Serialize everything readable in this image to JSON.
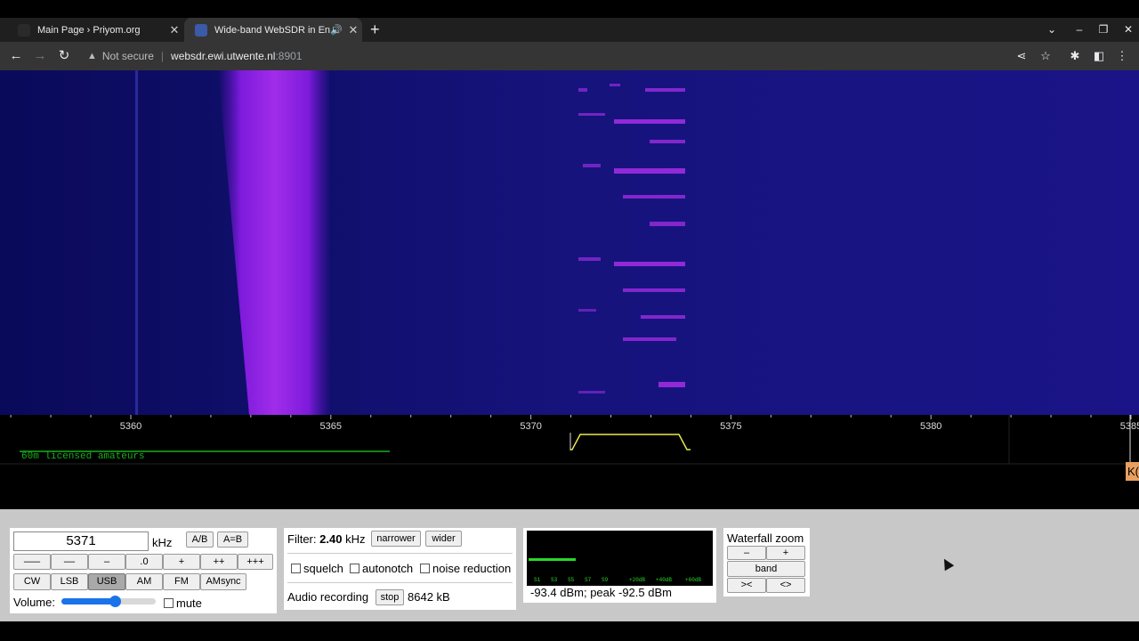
{
  "browser": {
    "tabs": [
      {
        "title": "Main Page › Priyom.org",
        "active": false
      },
      {
        "title": "Wide-band WebSDR in Ensch",
        "active": true
      }
    ],
    "url_warning": "Not secure",
    "url_host": "websdr.ewi.utwente.nl",
    "url_port": ":8901"
  },
  "scale": {
    "unit_labels": [
      "5360",
      "5365",
      "5370",
      "5375",
      "5380",
      "5385"
    ],
    "band_label": "60m licensed amateurs",
    "marker_label": "K("
  },
  "tuning": {
    "frequency": "5371",
    "unit": "kHz",
    "ab_label": "A/B",
    "aeqb_label": "A=B",
    "step_buttons": [
      "–––",
      "––",
      "–",
      ".0",
      "+",
      "++",
      "+++"
    ],
    "modes": [
      "CW",
      "LSB",
      "USB",
      "AM",
      "FM",
      "AMsync"
    ],
    "selected_mode": "USB",
    "volume_label": "Volume:",
    "volume_level": 0.57,
    "mute_label": "mute"
  },
  "filter": {
    "label": "Filter:",
    "width": "2.40",
    "unit": "kHz",
    "narrower": "narrower",
    "wider": "wider",
    "squelch": "squelch",
    "autonotch": "autonotch",
    "noise_reduction": "noise reduction",
    "recording_label": "Audio recording",
    "stop": "stop",
    "recorded_size": "8642 kB"
  },
  "smeter": {
    "labels": [
      "S1",
      "S3",
      "S5",
      "S7",
      "S9",
      "+20dB",
      "+40dB",
      "+60dB"
    ],
    "level": 0.26,
    "reading": "-93.4 dBm; peak  -92.5 dBm"
  },
  "zoom": {
    "title": "Waterfall zoom",
    "minus": "–",
    "plus": "+",
    "band": "band",
    "narrow": "><",
    "widen": "<>"
  },
  "colors": {
    "waterfall_bg": "#14117a",
    "signal": "#a020f0",
    "passband": "#e8e84a",
    "band_line": "#18b018",
    "marker": "#e8a060"
  }
}
